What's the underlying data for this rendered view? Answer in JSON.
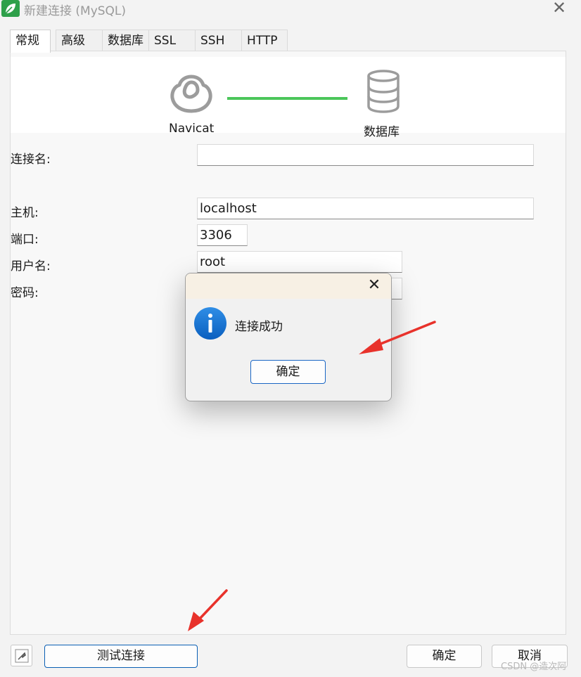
{
  "window": {
    "title": "新建连接 (MySQL)",
    "close_glyph": "✕",
    "app_icon": "navicat-leaf-icon"
  },
  "tabs": [
    {
      "label": "常规",
      "active": true
    },
    {
      "label": "高级",
      "active": false
    },
    {
      "label": "数据库",
      "active": false
    },
    {
      "label": "SSL",
      "active": false
    },
    {
      "label": "SSH",
      "active": false
    },
    {
      "label": "HTTP",
      "active": false
    }
  ],
  "header": {
    "left_label": "Navicat",
    "right_label": "数据库",
    "left_icon": "navicat-logo-icon",
    "right_icon": "database-icon",
    "link_color": "#4bc65a"
  },
  "form": {
    "connection_name": {
      "label": "连接名:",
      "value": ""
    },
    "host": {
      "label": "主机:",
      "value": "localhost"
    },
    "port": {
      "label": "端口:",
      "value": "3306"
    },
    "username": {
      "label": "用户名:",
      "value": "root"
    },
    "password": {
      "label": "密码:",
      "value": ""
    }
  },
  "footer": {
    "test_button": "测试连接",
    "ok_button": "确定",
    "cancel_button": "取消",
    "tool_icon": "connection-tool-icon"
  },
  "dialog": {
    "message": "连接成功",
    "ok_button": "确定",
    "close_glyph": "✕",
    "icon": "info-icon",
    "accent_color": "#1a66c4"
  },
  "annotation_color": "#e8322b",
  "watermark": "CSDN @造次阿"
}
